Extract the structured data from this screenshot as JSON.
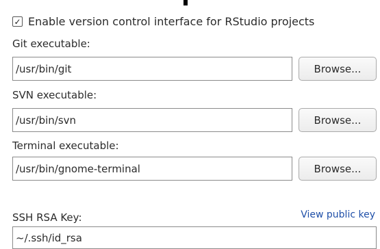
{
  "vcs": {
    "enable_checked": true,
    "enable_check_glyph": "✓",
    "enable_label": "Enable version control interface for RStudio projects",
    "git": {
      "label": "Git executable:",
      "value": "/usr/bin/git",
      "browse_label": "Browse..."
    },
    "svn": {
      "label": "SVN executable:",
      "value": "/usr/bin/svn",
      "browse_label": "Browse..."
    },
    "terminal": {
      "label": "Terminal executable:",
      "value": "/usr/bin/gnome-terminal",
      "browse_label": "Browse..."
    },
    "ssh": {
      "label": "SSH RSA Key:",
      "view_key_label": "View public key",
      "value": "~/.ssh/id_rsa"
    }
  },
  "colors": {
    "link": "#1f4fa8",
    "border": "#8a8a8a"
  }
}
